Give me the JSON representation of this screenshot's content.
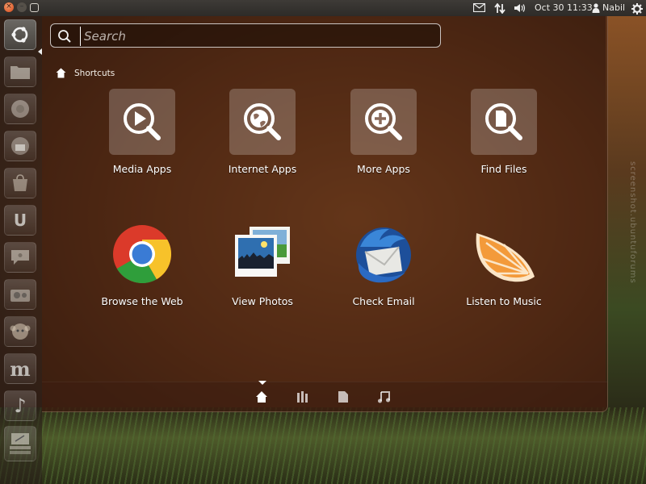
{
  "panel": {
    "clock": "Oct 30 11:33",
    "user": "Nabil",
    "close_glyph": "×",
    "min_glyph": "–",
    "max_glyph": "□"
  },
  "launcher": {
    "items": [
      {
        "name": "bfb",
        "glyph": ""
      },
      {
        "name": "home-folder",
        "glyph": ""
      },
      {
        "name": "chromium",
        "glyph": ""
      },
      {
        "name": "thunderbird",
        "glyph": ""
      },
      {
        "name": "software-center",
        "glyph": ""
      },
      {
        "name": "ubuntu-one",
        "glyph": "U"
      },
      {
        "name": "empathy",
        "glyph": ""
      },
      {
        "name": "gwibber",
        "glyph": ""
      },
      {
        "name": "pidgin",
        "glyph": ""
      },
      {
        "name": "mint",
        "glyph": "m"
      },
      {
        "name": "music",
        "glyph": "♪"
      },
      {
        "name": "workspace-switcher",
        "glyph": ""
      }
    ]
  },
  "search": {
    "placeholder": "Search"
  },
  "breadcrumb": {
    "label": "Shortcuts"
  },
  "tiles": [
    {
      "label": "Media Apps"
    },
    {
      "label": "Internet Apps"
    },
    {
      "label": "More Apps"
    },
    {
      "label": "Find Files"
    },
    {
      "label": "Browse the Web"
    },
    {
      "label": "View Photos"
    },
    {
      "label": "Check Email"
    },
    {
      "label": "Listen to Music"
    }
  ],
  "filters": [
    {
      "name": "home"
    },
    {
      "name": "applications"
    },
    {
      "name": "files"
    },
    {
      "name": "music"
    }
  ],
  "watermark": "screenshot.ubuntuforums",
  "colors": {
    "dash_bg": "#3c1c0e",
    "accent_orange": "#f08a2a",
    "chrome_red": "#db3a2a",
    "chrome_green": "#2f9e3b",
    "chrome_yellow": "#f7c22a",
    "chrome_blue": "#3a7bd5"
  }
}
